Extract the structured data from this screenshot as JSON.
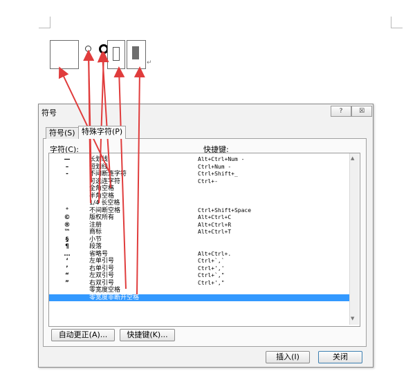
{
  "document": {
    "paragraph_mark": "↵"
  },
  "dialog": {
    "title": "符号",
    "help_label": "?",
    "close_label": "☒",
    "tabs": [
      {
        "label": "符号(S)",
        "active": false
      },
      {
        "label": "特殊字符(P)",
        "active": true
      }
    ],
    "column_char": "字符(C):",
    "column_shortcut": "快捷键:",
    "rows": [
      {
        "glyph": "—",
        "name": "长划线",
        "key": "Alt+Ctrl+Num -"
      },
      {
        "glyph": "–",
        "name": "短划线",
        "key": "Ctrl+Num -"
      },
      {
        "glyph": "-",
        "name": "不间断连字符",
        "key": "Ctrl+Shift+_"
      },
      {
        "glyph": "",
        "name": "可选连字符",
        "key": "Ctrl+-"
      },
      {
        "glyph": "",
        "name": "全角空格",
        "key": ""
      },
      {
        "glyph": "",
        "name": "半角空格",
        "key": ""
      },
      {
        "glyph": "",
        "name": "1/4 长空格",
        "key": ""
      },
      {
        "glyph": "°",
        "name": "不间断空格",
        "key": "Ctrl+Shift+Space"
      },
      {
        "glyph": "©",
        "name": "版权所有",
        "key": "Alt+Ctrl+C"
      },
      {
        "glyph": "®",
        "name": "注册",
        "key": "Alt+Ctrl+R"
      },
      {
        "glyph": "™",
        "name": "商标",
        "key": "Alt+Ctrl+T"
      },
      {
        "glyph": "§",
        "name": "小节",
        "key": ""
      },
      {
        "glyph": "¶",
        "name": "段落",
        "key": ""
      },
      {
        "glyph": "…",
        "name": "省略号",
        "key": "Alt+Ctrl+."
      },
      {
        "glyph": "‘",
        "name": "左单引号",
        "key": "Ctrl+`,`"
      },
      {
        "glyph": "’",
        "name": "右单引号",
        "key": "Ctrl+','"
      },
      {
        "glyph": "“",
        "name": "左双引号",
        "key": "Ctrl+`,\""
      },
      {
        "glyph": "”",
        "name": "右双引号",
        "key": "Ctrl+',\""
      },
      {
        "glyph": "",
        "name": "零宽度空格",
        "key": ""
      },
      {
        "glyph": "",
        "name": "零宽度非断开空格",
        "key": "",
        "selected": true
      }
    ],
    "buttons": {
      "autocorrect": "自动更正(A)...",
      "shortcut": "快捷键(K)...",
      "insert": "插入(I)",
      "close": "关闭"
    },
    "scroll_up": "▲",
    "scroll_down": "▼"
  },
  "colors": {
    "selection": "#3399ff",
    "arrow": "#e03c3c"
  }
}
